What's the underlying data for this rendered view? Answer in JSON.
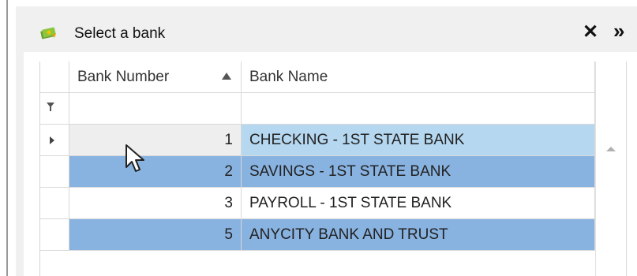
{
  "dialog": {
    "title": "Select a bank",
    "title_icon": "money-icon",
    "close_icon": "close-icon",
    "expand_icon": "double-chevron-right-icon"
  },
  "grid": {
    "columns": [
      {
        "label": "Bank Number",
        "sort": "ascending"
      },
      {
        "label": "Bank Name"
      }
    ],
    "filter_icon": "filter-icon",
    "rows": [
      {
        "number": "1",
        "name": "CHECKING - 1ST STATE BANK",
        "state": "focused"
      },
      {
        "number": "2",
        "name": "SAVINGS - 1ST STATE BANK",
        "state": "selected"
      },
      {
        "number": "3",
        "name": "PAYROLL - 1ST STATE BANK",
        "state": "normal"
      },
      {
        "number": "5",
        "name": "ANYCITY BANK AND TRUST",
        "state": "selected"
      }
    ]
  },
  "colors": {
    "focused_row": "#b5d7f0",
    "selected_row": "#88b2e0",
    "header_background": "#f0f0f0"
  }
}
